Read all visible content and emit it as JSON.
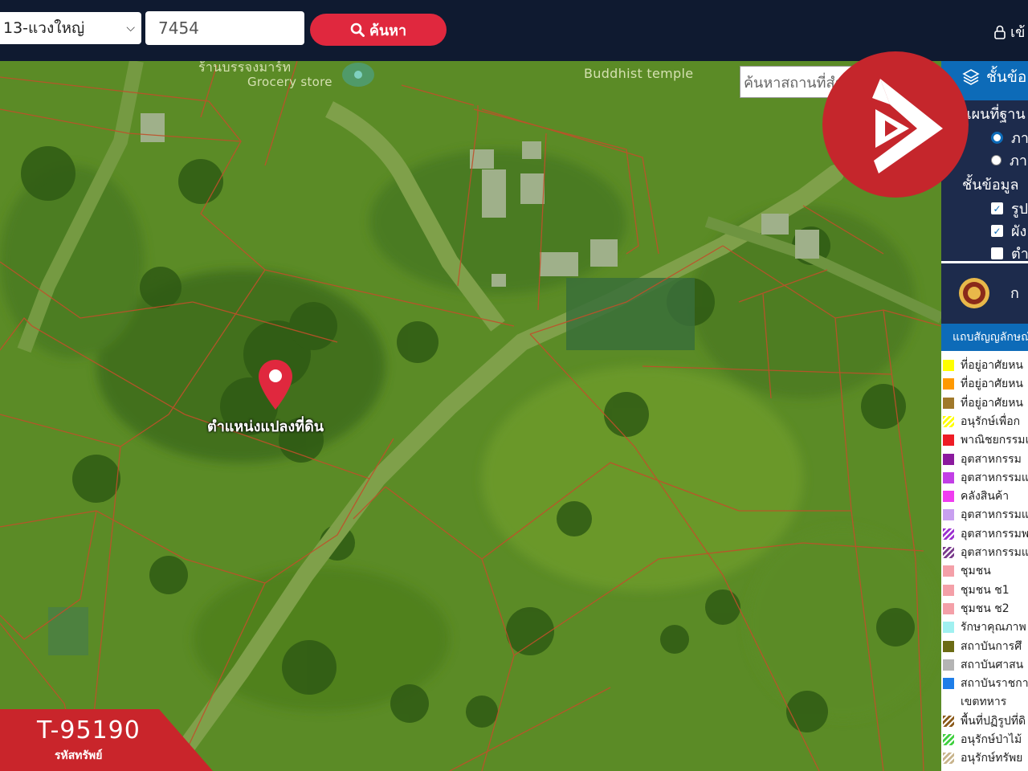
{
  "toolbar": {
    "district_select": "13-แวงใหญ่",
    "search_value": "7454",
    "search_button": "ค้นหา",
    "login_label": "เข้"
  },
  "map": {
    "labels": {
      "grocery_thai": "ร้านบรรจงมาร์ท",
      "grocery_en": "Grocery store",
      "temple_en": "Buddhist temple"
    },
    "place_search_placeholder": "ค้นหาสถานที่สำคัญ",
    "marker_label": "ตำแหน่งแปลงที่ดิน"
  },
  "sidebar": {
    "header_label": "ชั้นข้อ",
    "basemap_heading": "แผนที่ฐาน",
    "basemap_options": [
      {
        "label": "ภา",
        "selected": true
      },
      {
        "label": "ภา",
        "selected": false
      }
    ],
    "layers_heading": "ชั้นข้อมูล",
    "layers": [
      {
        "label": "รูป",
        "checked": true
      },
      {
        "label": "ผัง",
        "checked": true
      },
      {
        "label": "ตำ",
        "checked": false
      }
    ],
    "emblem_label": "ก",
    "legend_title": "แถบสัญญลักษณ์",
    "legend_items": [
      {
        "label": "ที่อยู่อาศัยหน",
        "color": "#ffff00",
        "pattern": "solid"
      },
      {
        "label": "ที่อยู่อาศัยหน",
        "color": "#ff9900",
        "pattern": "solid"
      },
      {
        "label": "ที่อยู่อาศัยหน",
        "color": "#a0782a",
        "pattern": "solid"
      },
      {
        "label": "อนุรักษ์เพื่อก",
        "color": "#ffff00",
        "pattern": "hatch"
      },
      {
        "label": "พาณิชยกรรมแ",
        "color": "#ee1c25",
        "pattern": "solid"
      },
      {
        "label": "อุตสาหกรรม",
        "color": "#8b1a9e",
        "pattern": "solid"
      },
      {
        "label": "อุตสาหกรรมแ",
        "color": "#c23fe6",
        "pattern": "solid"
      },
      {
        "label": "คลังสินค้า",
        "color": "#f03cf0",
        "pattern": "solid"
      },
      {
        "label": "อุตสาหกรรมแ",
        "color": "#c8a0f0",
        "pattern": "solid"
      },
      {
        "label": "อุตสาหกรรมพ",
        "color": "#9b30d0",
        "pattern": "hatch"
      },
      {
        "label": "อุตสาหกรรมแ",
        "color": "#7a3c8c",
        "pattern": "hatch"
      },
      {
        "label": "ชุมชน",
        "color": "#f4a0a8",
        "pattern": "solid"
      },
      {
        "label": "ชุมชน ช1",
        "color": "#f4a0a8",
        "pattern": "solid"
      },
      {
        "label": "ชุมชน ช2",
        "color": "#f4a0a8",
        "pattern": "solid"
      },
      {
        "label": "รักษาคุณภาพ",
        "color": "#a0f0f0",
        "pattern": "solid"
      },
      {
        "label": "สถาบันการศึ",
        "color": "#6b6b14",
        "pattern": "solid"
      },
      {
        "label": "สถาบันศาสน",
        "color": "#b4b4b4",
        "pattern": "solid"
      },
      {
        "label": "สถาบันราชกา",
        "color": "#1e7ee8",
        "pattern": "solid"
      },
      {
        "label": "เขตทหาร",
        "color": "#ffffff",
        "pattern": "solid"
      },
      {
        "label": "พื้นที่ปฏิรูปที่ดิ",
        "color": "#8b5a1a",
        "pattern": "hatch"
      },
      {
        "label": "อนุรักษ์ป่าไม้",
        "color": "#40d040",
        "pattern": "hatch"
      },
      {
        "label": "อนุรักษ์ทรัพย",
        "color": "#c8b48c",
        "pattern": "hatch"
      }
    ]
  },
  "badge": {
    "code": "T-95190",
    "subtitle": "รหัสทรัพย์"
  },
  "colors": {
    "topbar": "#0f1a30",
    "accent_red": "#e0283e",
    "sidebar_blue": "#0d6bb8",
    "sidebar_dark": "#1d2b4c",
    "logo_red": "#c5262c"
  }
}
